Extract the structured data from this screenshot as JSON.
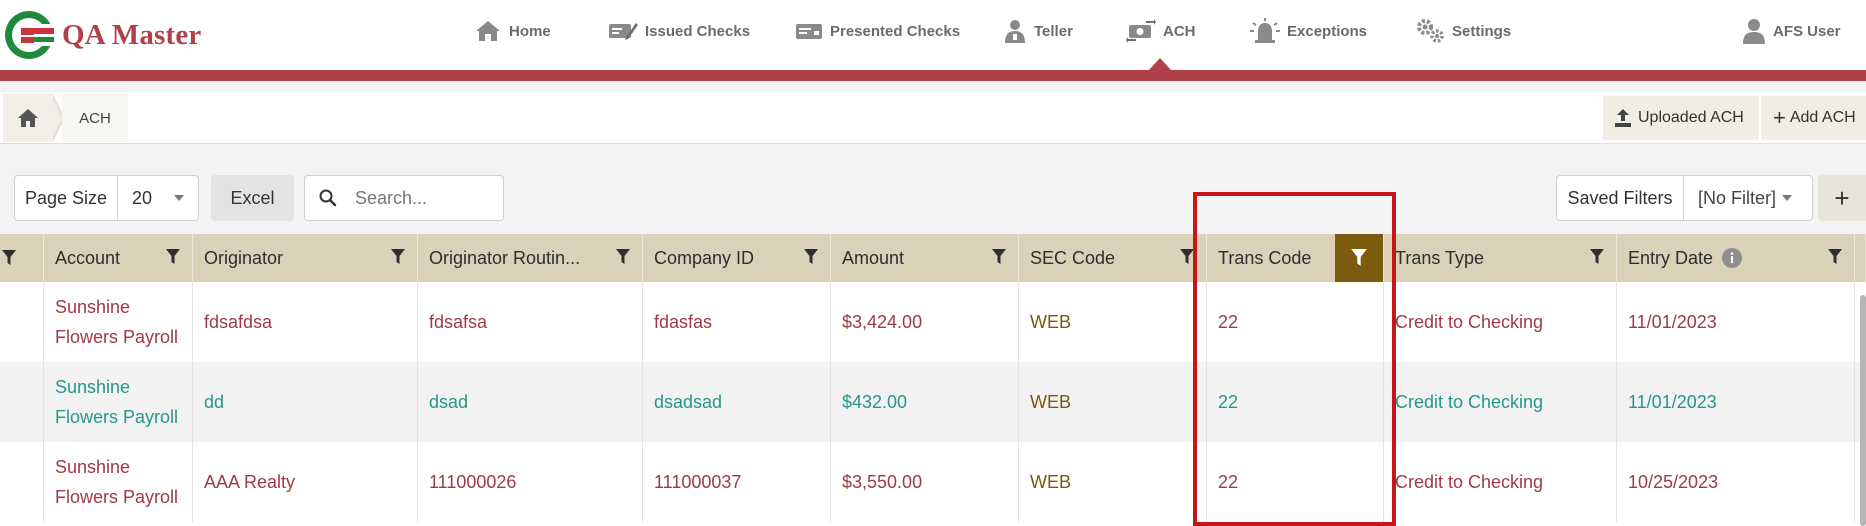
{
  "app": {
    "name": "QA Master"
  },
  "nav": {
    "items": [
      {
        "label": "Home",
        "icon": "home-icon"
      },
      {
        "label": "Issued Checks",
        "icon": "check-pen-icon"
      },
      {
        "label": "Presented Checks",
        "icon": "check-card-icon"
      },
      {
        "label": "Teller",
        "icon": "teller-icon"
      },
      {
        "label": "ACH",
        "icon": "ach-transfer-icon"
      },
      {
        "label": "Exceptions",
        "icon": "alarm-icon"
      },
      {
        "label": "Settings",
        "icon": "gears-icon"
      }
    ],
    "active": "ACH",
    "user": "AFS User"
  },
  "breadcrumb": {
    "current": "ACH"
  },
  "toolbar_actions": {
    "uploaded": "Uploaded ACH",
    "add": "Add ACH"
  },
  "toolbar": {
    "page_size_label": "Page Size",
    "page_size_value": "20",
    "excel": "Excel",
    "search_placeholder": "Search...",
    "saved_filters_label": "Saved Filters",
    "saved_filters_value": "[No Filter]",
    "plus": "+"
  },
  "table": {
    "columns": [
      "Account",
      "Originator",
      "Originator Routin...",
      "Company ID",
      "Amount",
      "SEC Code",
      "Trans Code",
      "Trans Type",
      "Entry Date"
    ],
    "active_filter_column": "Trans Code",
    "rows": [
      {
        "account_1": "Sunshine",
        "account_2": "Flowers Payroll",
        "originator": "fdsafdsa",
        "routing": "fdsafsa",
        "company_id": "fdasfas",
        "amount": "$3,424.00",
        "sec": "WEB",
        "trans_code": "22",
        "trans_type": "Credit to Checking",
        "entry_date": "11/01/2023",
        "tone": "red"
      },
      {
        "account_1": "Sunshine",
        "account_2": "Flowers Payroll",
        "originator": "dd",
        "routing": "dsad",
        "company_id": "dsadsad",
        "amount": "$432.00",
        "sec": "WEB",
        "trans_code": "22",
        "trans_type": "Credit to Checking",
        "entry_date": "11/01/2023",
        "tone": "teal"
      },
      {
        "account_1": "Sunshine",
        "account_2": "Flowers Payroll",
        "originator": "AAA Realty",
        "routing": "111000026",
        "company_id": "111000037",
        "amount": "$3,550.00",
        "sec": "WEB",
        "trans_code": "22",
        "trans_type": "Credit to Checking",
        "entry_date": "10/25/2023",
        "tone": "red"
      }
    ]
  },
  "colors": {
    "brand": "#b2404b",
    "header": "#dad2b8",
    "active_filter": "#7d5c0f",
    "highlight": "#c6161a"
  }
}
